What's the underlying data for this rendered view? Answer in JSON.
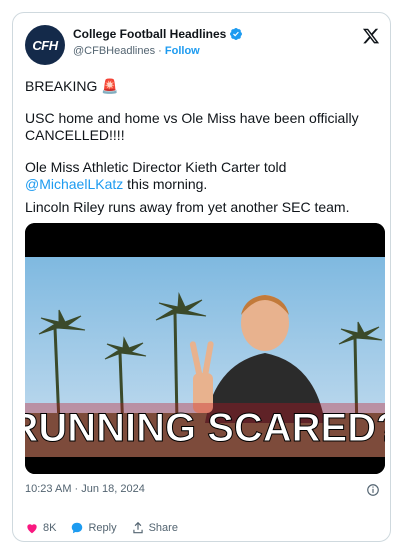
{
  "account": {
    "avatar_text": "CFH",
    "name": "College Football Headlines",
    "handle": "@CFBHeadlines",
    "separator": "·",
    "follow_label": "Follow"
  },
  "tweet": {
    "line1": "BREAKING 🚨",
    "para2": "USC home and home vs Ole Miss have been officially CANCELLED!!!!",
    "para3_before": "Ole Miss Athletic Director Kieth Carter told ",
    "para3_mention": "@MichaelLKatz",
    "para3_after": " this morning.",
    "para4": "Lincoln Riley runs away from yet another SEC team."
  },
  "media": {
    "overlay_text": "RUNNING SCARED?"
  },
  "meta": {
    "timestamp": "10:23 AM · Jun 18, 2024"
  },
  "actions": {
    "like_count": "8K",
    "reply_label": "Reply",
    "share_label": "Share"
  },
  "colors": {
    "accent": "#1d9bf0",
    "text": "#0f1419",
    "muted": "#536471",
    "overlay_band": "#c1121f"
  }
}
